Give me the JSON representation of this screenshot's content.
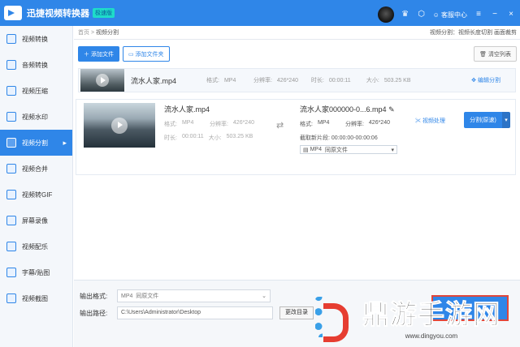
{
  "titlebar": {
    "app_title": "迅捷视频转换器",
    "badge": "极速版",
    "help_label": "客服中心"
  },
  "sidebar": {
    "items": [
      {
        "label": "视频转换"
      },
      {
        "label": "音频转换"
      },
      {
        "label": "视频压缩"
      },
      {
        "label": "视频水印"
      },
      {
        "label": "视频分割",
        "active": true
      },
      {
        "label": "视频合并"
      },
      {
        "label": "视频转GIF"
      },
      {
        "label": "屏幕录像"
      },
      {
        "label": "视频配乐"
      },
      {
        "label": "字幕/贴图"
      },
      {
        "label": "视频截图"
      }
    ]
  },
  "breadcrumb": {
    "home": "首页",
    "sep": ">",
    "current": "视频分割",
    "right": "视频分割：视频长度切割 画面裁剪"
  },
  "toolbar": {
    "add_file": "添加文件",
    "add_folder": "添加文件夹",
    "clear_list": "清空列表"
  },
  "filerow": {
    "name": "流水人家.mp4",
    "format_label": "格式:",
    "format_val": "MP4",
    "res_label": "分辨率:",
    "res_val": "426*240",
    "dur_label": "时长:",
    "dur_val": "00:00:11",
    "size_label": "大小:",
    "size_val": "503.25 KB",
    "edit_split": "编辑分割"
  },
  "detail": {
    "src_name": "流水人家.mp4",
    "src_fmt_label": "格式:",
    "src_fmt": "MP4",
    "src_res_label": "分辨率:",
    "src_res": "426*240",
    "src_dur_label": "时长:",
    "src_dur": "00:00:11",
    "src_size_label": "大小:",
    "src_size": "503.25 KB",
    "out_name": "流水人家000000-0...6.mp4",
    "out_fmt_label": "格式:",
    "out_fmt": "MP4",
    "out_res_label": "分辨率:",
    "out_res": "426*240",
    "cut_label": "截取新片段: 00:00:00-00:00:06",
    "fmt_sel": "MP4",
    "fmt_sel2": "同原文件",
    "process": "视频处理",
    "split_btn": "分割(原速)"
  },
  "footer": {
    "fmt_label": "输出格式:",
    "fmt_val": "MP4",
    "fmt_val2": "同原文件",
    "path_label": "输出路径:",
    "path_val": "C:\\Users\\Administrator\\Desktop",
    "change_dir": "更改目录"
  },
  "watermark": {
    "text": "鼎游手游网",
    "url": "www.dingyou.com"
  }
}
